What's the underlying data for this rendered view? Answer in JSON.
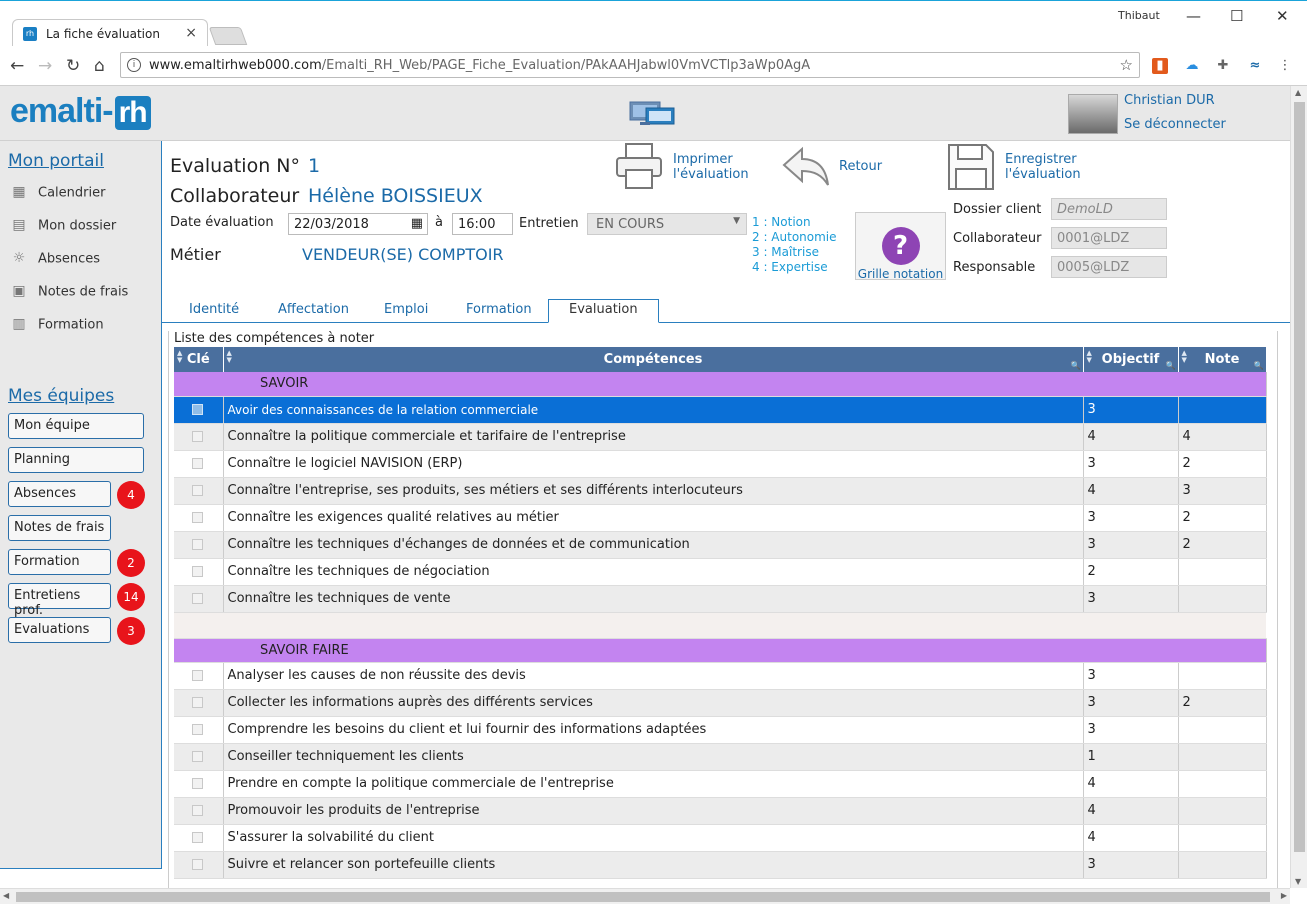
{
  "browser": {
    "tab_title": "La fiche évaluation",
    "user_chip": "Thibaut",
    "url_host": "www.emaltirhweb000.com",
    "url_path": "/Emalti_RH_Web/PAGE_Fiche_Evaluation/PAkAAHJabwl0VmVCTlp3aWp0AgA"
  },
  "header": {
    "logo_text": "emalti-",
    "logo_box": "rh",
    "user_name": "Christian DUR",
    "logout": "Se déconnecter"
  },
  "sidebar": {
    "portal_title": "Mon portail",
    "portal_items": [
      {
        "label": "Calendrier",
        "icon": "calendar-icon"
      },
      {
        "label": "Mon dossier",
        "icon": "id-card-icon"
      },
      {
        "label": "Absences",
        "icon": "sun-icon"
      },
      {
        "label": "Notes de frais",
        "icon": "receipt-icon"
      },
      {
        "label": "Formation",
        "icon": "book-icon"
      }
    ],
    "teams_title": "Mes équipes",
    "team_buttons": [
      {
        "label": "Mon équipe",
        "badge": ""
      },
      {
        "label": "Planning",
        "badge": ""
      },
      {
        "label": "Absences",
        "badge": "4"
      },
      {
        "label": "Notes de frais",
        "badge": ""
      },
      {
        "label": "Formation",
        "badge": "2"
      },
      {
        "label": "Entretiens prof.",
        "badge": "14"
      },
      {
        "label": "Evaluations",
        "badge": "3"
      }
    ]
  },
  "form": {
    "eval_label": "Evaluation N°",
    "eval_number": "1",
    "collab_label": "Collaborateur",
    "collab_name": "Hélène BOISSIEUX",
    "date_label": "Date évaluation",
    "date_value": "22/03/2018",
    "at_label": "à",
    "time_value": "16:00",
    "entretien_label": "Entretien",
    "entretien_value": "EN COURS",
    "metier_label": "Métier",
    "metier_value": "VENDEUR(SE) COMPTOIR",
    "legend": [
      "1 : Notion",
      "2 : Autonomie",
      "3 : Maîtrise",
      "4 : Expertise"
    ],
    "print_label_1": "Imprimer",
    "print_label_2": "l'évaluation",
    "back_label": "Retour",
    "save_label_1": "Enregistrer",
    "save_label_2": "l'évaluation",
    "grid_help_label": "Grille notation",
    "dossier_label": "Dossier client",
    "dossier_value": "DemoLD",
    "collab_code_label": "Collaborateur",
    "collab_code_value": "0001@LDZ",
    "resp_label": "Responsable",
    "resp_value": "0005@LDZ"
  },
  "tabs": [
    "Identité",
    "Affectation",
    "Emploi",
    "Formation",
    "Evaluation"
  ],
  "grid": {
    "caption": "Liste des compétences à noter",
    "columns": {
      "key": "Clé",
      "skill": "Compétences",
      "target": "Objectif",
      "note": "Note"
    },
    "categories": [
      {
        "name": "SAVOIR",
        "rows": [
          {
            "skill": "Avoir des connaissances de la relation commerciale",
            "target": "3",
            "note": ""
          },
          {
            "skill": "Connaître la politique commerciale et tarifaire de l'entreprise",
            "target": "4",
            "note": "4"
          },
          {
            "skill": "Connaître le logiciel NAVISION (ERP)",
            "target": "3",
            "note": "2"
          },
          {
            "skill": "Connaître l'entreprise, ses produits, ses métiers et ses différents interlocuteurs",
            "target": "4",
            "note": "3"
          },
          {
            "skill": "Connaître les exigences qualité relatives au métier",
            "target": "3",
            "note": "2"
          },
          {
            "skill": "Connaître les techniques d'échanges de données et de communication",
            "target": "3",
            "note": "2"
          },
          {
            "skill": "Connaître les techniques de négociation",
            "target": "2",
            "note": ""
          },
          {
            "skill": "Connaître les techniques de vente",
            "target": "3",
            "note": ""
          }
        ]
      },
      {
        "name": "SAVOIR FAIRE",
        "rows": [
          {
            "skill": "Analyser les causes de non réussite des devis",
            "target": "3",
            "note": ""
          },
          {
            "skill": "Collecter les informations auprès des différents services",
            "target": "3",
            "note": "2"
          },
          {
            "skill": "Comprendre les besoins du client et lui fournir des informations adaptées",
            "target": "3",
            "note": ""
          },
          {
            "skill": "Conseiller techniquement les clients",
            "target": "1",
            "note": ""
          },
          {
            "skill": "Prendre en compte la politique commerciale de l'entreprise",
            "target": "4",
            "note": ""
          },
          {
            "skill": "Promouvoir les produits de l'entreprise",
            "target": "4",
            "note": ""
          },
          {
            "skill": "S'assurer la solvabilité du client",
            "target": "4",
            "note": ""
          },
          {
            "skill": "Suivre et relancer son portefeuille clients",
            "target": "3",
            "note": ""
          }
        ]
      }
    ]
  },
  "colors": {
    "accent": "#1b6aa8",
    "header_bg": "#4a6f9e",
    "category_bg": "#c384f0",
    "selected_row": "#0a6fd6",
    "badge": "#e8141b"
  }
}
